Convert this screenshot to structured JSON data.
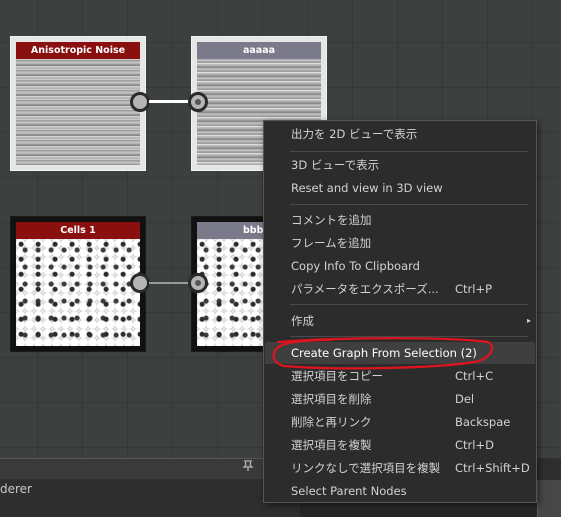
{
  "graph": {
    "nodes": [
      {
        "id": "anisotropic",
        "title": "Anisotropic Noise",
        "title_color": "#8a1010"
      },
      {
        "id": "aaaaa",
        "title": "aaaaa",
        "title_color": "#7a7a8a"
      },
      {
        "id": "cells1",
        "title": "Cells 1",
        "title_color": "#8a1010"
      },
      {
        "id": "bbbb",
        "title": "bbbb",
        "title_color": "#7a7a8a"
      }
    ]
  },
  "context_menu": {
    "items": [
      {
        "label": "出力を 2D ビューで表示",
        "shortcut": ""
      },
      {
        "label": "3D ビューで表示",
        "shortcut": ""
      },
      {
        "label": "Reset and view in 3D view",
        "shortcut": ""
      },
      {
        "label": "コメントを追加",
        "shortcut": ""
      },
      {
        "label": "フレームを追加",
        "shortcut": ""
      },
      {
        "label": "Copy Info To Clipboard",
        "shortcut": ""
      },
      {
        "label": "パラメータをエクスポーズ...",
        "shortcut": "Ctrl+P"
      },
      {
        "label": "作成",
        "shortcut": ""
      },
      {
        "label": "Create Graph From Selection (2)",
        "shortcut": ""
      },
      {
        "label": "選択項目をコピー",
        "shortcut": "Ctrl+C"
      },
      {
        "label": "選択項目を削除",
        "shortcut": "Del"
      },
      {
        "label": "削除と再リンク",
        "shortcut": "Backspae"
      },
      {
        "label": "選択項目を複製",
        "shortcut": "Ctrl+D"
      },
      {
        "label": "リンクなしで選択項目を複製",
        "shortcut": "Ctrl+Shift+D"
      },
      {
        "label": "Select Parent Nodes",
        "shortcut": ""
      }
    ],
    "submenu_arrow": "▸",
    "highlight_color": "#3f3f3f",
    "annotation_color": "#e0141e"
  },
  "bottom_panel": {
    "label": "derer",
    "pin_icon": "pin-icon"
  }
}
